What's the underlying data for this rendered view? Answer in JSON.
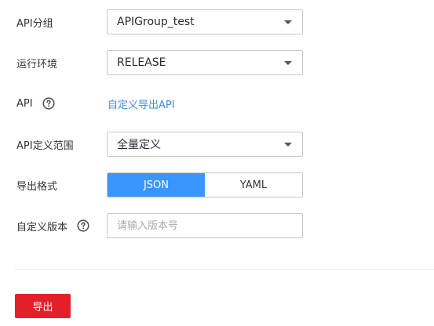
{
  "form": {
    "api_group": {
      "label": "API分组",
      "value": "APIGroup_test"
    },
    "environment": {
      "label": "运行环境",
      "value": "RELEASE"
    },
    "api": {
      "label": "API",
      "help_icon": "question-circle-icon",
      "link_text": "自定义导出API"
    },
    "api_scope": {
      "label": "API定义范围",
      "value": "全量定义"
    },
    "export_format": {
      "label": "导出格式",
      "options": [
        "JSON",
        "YAML"
      ],
      "selected": "JSON"
    },
    "custom_version": {
      "label": "自定义版本",
      "help_icon": "question-circle-icon",
      "value": "",
      "placeholder": "请输入版本号"
    }
  },
  "footer": {
    "export_button": "导出"
  },
  "colors": {
    "accent": "#3b95ff",
    "link": "#3a8ee6",
    "primary_button": "#e3202a",
    "border": "#c8c8c8"
  }
}
